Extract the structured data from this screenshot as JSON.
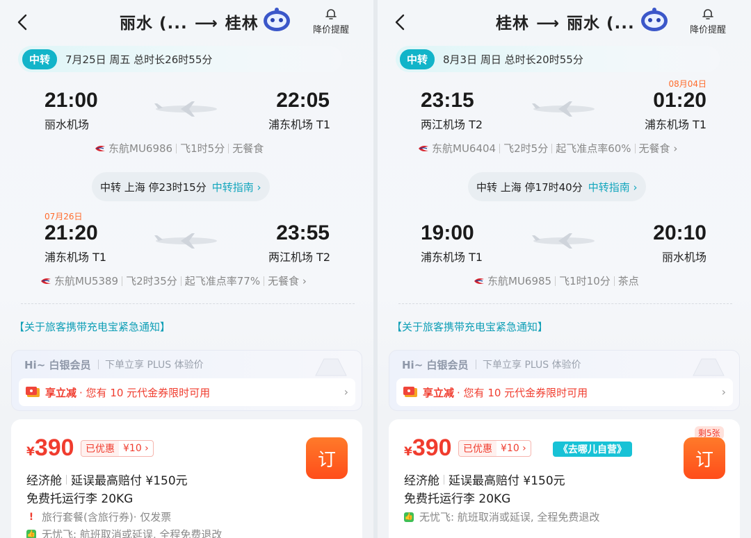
{
  "left": {
    "title": "丽水 (...",
    "title_to": "桂林",
    "arrow": "→",
    "alert_label": "降价提醒",
    "transit_tag": "中转",
    "transit_info": "7月25日 周五  总时长26时55分",
    "leg1": {
      "dep_time": "21:00",
      "dep_airport": "丽水机场",
      "arr_time": "22:05",
      "arr_airport": "浦东机场 T1",
      "airline": "东航MU6986",
      "duration": "飞1时5分",
      "meal": "无餐食"
    },
    "stop": {
      "label": "中转 上海 停23时15分",
      "guide": "中转指南 ›"
    },
    "leg2": {
      "date": "07月26日",
      "dep_time": "21:20",
      "dep_airport": "浦东机场 T1",
      "arr_time": "23:55",
      "arr_airport": "两江机场 T2",
      "airline": "东航MU5389",
      "duration": "飞2时35分",
      "ontime": "起飞准点率77%",
      "meal": "无餐食 ›"
    },
    "notice": "【关于旅客携带充电宝紧急通知】",
    "member_hi": "Hi~ 白银会员",
    "member_plus": "下单立享 PLUS 体验价",
    "coupon_tag": "享立减",
    "coupon_text": "· 您有 10 元代金券限时可用",
    "price_symbol": "¥",
    "price": "390",
    "discount_a": "已优惠",
    "discount_b": "¥10 ›",
    "book": "订",
    "cabin": "经济舱",
    "delay": "延误最高赔付 ¥150元",
    "baggage": "免费托运行李 20KG",
    "feature1": "旅行套餐(含旅行券)· 仅发票",
    "feature2": "无忧飞: 航班取消或延误, 全程免费退改"
  },
  "right": {
    "title": "桂林",
    "title_to": "丽水 (...",
    "arrow": "→",
    "alert_label": "降价提醒",
    "transit_tag": "中转",
    "transit_info": "8月3日 周日  总时长20时55分",
    "leg1": {
      "dep_time": "23:15",
      "dep_airport": "两江机场 T2",
      "arr_date": "08月04日",
      "arr_time": "01:20",
      "arr_airport": "浦东机场 T1",
      "airline": "东航MU6404",
      "duration": "飞2时5分",
      "ontime": "起飞准点率60%",
      "meal": "无餐食 ›"
    },
    "stop": {
      "label": "中转 上海 停17时40分",
      "guide": "中转指南 ›"
    },
    "leg2": {
      "dep_time": "19:00",
      "dep_airport": "浦东机场 T1",
      "arr_time": "20:10",
      "arr_airport": "丽水机场",
      "airline": "东航MU6985",
      "duration": "飞1时10分",
      "meal": "茶点"
    },
    "notice": "【关于旅客携带充电宝紧急通知】",
    "member_hi": "Hi~ 白银会员",
    "member_plus": "下单立享 PLUS 体验价",
    "coupon_tag": "享立减",
    "coupon_text": "· 您有 10 元代金券限时可用",
    "price_symbol": "¥",
    "price": "390",
    "discount_a": "已优惠",
    "discount_b": "¥10 ›",
    "selfrun": "《去哪儿自营》",
    "remain": "剩5张",
    "book": "订",
    "cabin": "经济舱",
    "delay": "延误最高赔付 ¥150元",
    "baggage": "免费托运行李 20KG",
    "feature2": "无忧飞: 航班取消或延误, 全程免费退改"
  },
  "colors": {
    "accent": "#12b4c9",
    "price": "#f03c2e",
    "book": "#ff5a1f",
    "date_orange": "#ff6b2b"
  },
  "icons": [
    "back-chevron-icon",
    "robot-assistant-icon",
    "bell-icon",
    "plane-icon",
    "china-eastern-logo-icon",
    "ticket-icon",
    "chevron-right-icon"
  ]
}
